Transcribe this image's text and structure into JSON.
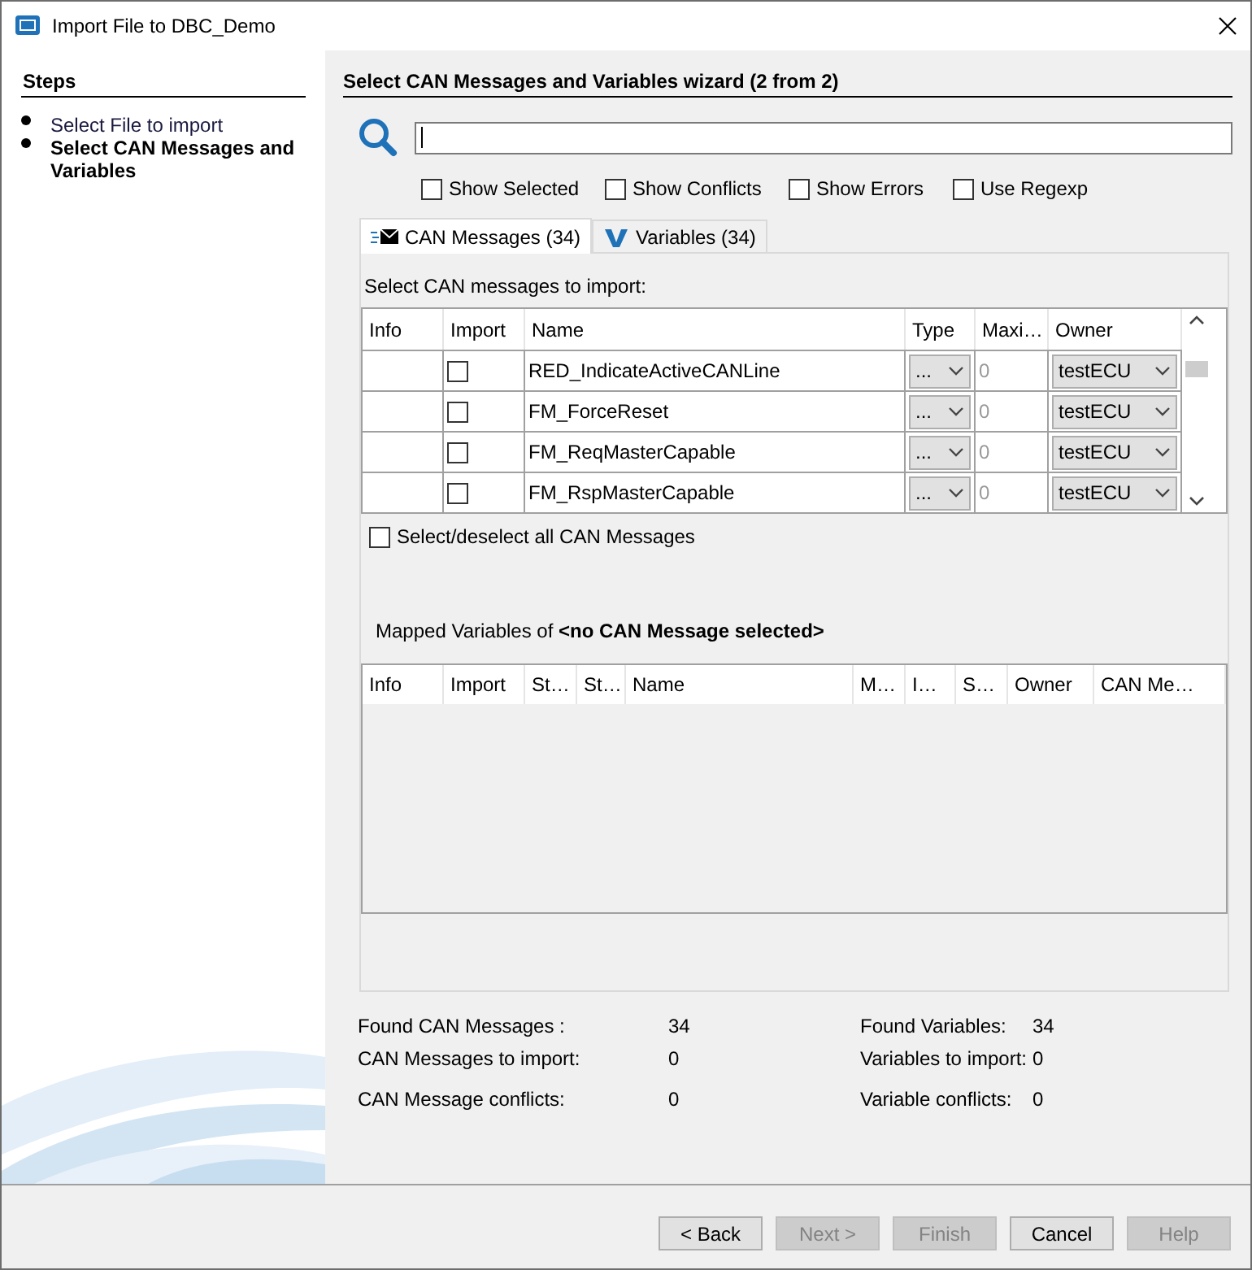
{
  "window": {
    "title": "Import File to DBC_Demo"
  },
  "steps": {
    "title": "Steps",
    "items": [
      {
        "label": "Select File to import",
        "selected": false
      },
      {
        "label": "Select CAN Messages and Variables",
        "selected": true
      }
    ]
  },
  "wizard": {
    "title": "Select CAN Messages and Variables wizard (2 from 2)"
  },
  "filters": [
    {
      "label": "Show Selected",
      "checked": false
    },
    {
      "label": "Show Conflicts",
      "checked": false
    },
    {
      "label": "Show Errors",
      "checked": false
    },
    {
      "label": "Use Regexp",
      "checked": false
    }
  ],
  "tabs": [
    {
      "label": "CAN Messages (34)",
      "selected": true,
      "kind": "messages"
    },
    {
      "label": "Variables (34)",
      "selected": false,
      "kind": "variables"
    }
  ],
  "messages": {
    "caption": "Select CAN messages to import:",
    "columns": [
      "Info",
      "Import",
      "Name",
      "Type",
      "Maxi…",
      "Owner"
    ],
    "rows": [
      {
        "import": false,
        "name": "RED_IndicateActiveCANLine",
        "type": "...",
        "maximum": "0",
        "owner": "testECU"
      },
      {
        "import": false,
        "name": "FM_ForceReset",
        "type": "...",
        "maximum": "0",
        "owner": "testECU"
      },
      {
        "import": false,
        "name": "FM_ReqMasterCapable",
        "type": "...",
        "maximum": "0",
        "owner": "testECU"
      },
      {
        "import": false,
        "name": "FM_RspMasterCapable",
        "type": "...",
        "maximum": "0",
        "owner": "testECU"
      }
    ],
    "select_all": {
      "label": "Select/deselect all CAN Messages",
      "checked": false
    }
  },
  "mapped": {
    "caption": "Mapped Variables of **<no CAN Message selected>**",
    "columns": [
      "Info",
      "Import",
      "St…",
      "St…",
      "Name",
      "M…",
      "I…",
      "S…",
      "Owner",
      "CAN Me…"
    ]
  },
  "summary_left": [
    {
      "label": "Found CAN Messages :",
      "value": "34"
    },
    {
      "label": "CAN Messages to import:",
      "value": "0"
    },
    {
      "label": "CAN Message conflicts:",
      "value": "0"
    }
  ],
  "summary_right": [
    {
      "label": "Found Variables:",
      "value": "34"
    },
    {
      "label": "Variables to import:",
      "value": "0"
    },
    {
      "label": "Variable conflicts:",
      "value": "0"
    }
  ],
  "buttons": [
    {
      "label": "< Back",
      "disabled": false
    },
    {
      "label": "Next >",
      "disabled": true
    },
    {
      "label": "Finish",
      "disabled": true
    },
    {
      "label": "Cancel",
      "disabled": false
    },
    {
      "label": "Help",
      "disabled": true
    }
  ]
}
